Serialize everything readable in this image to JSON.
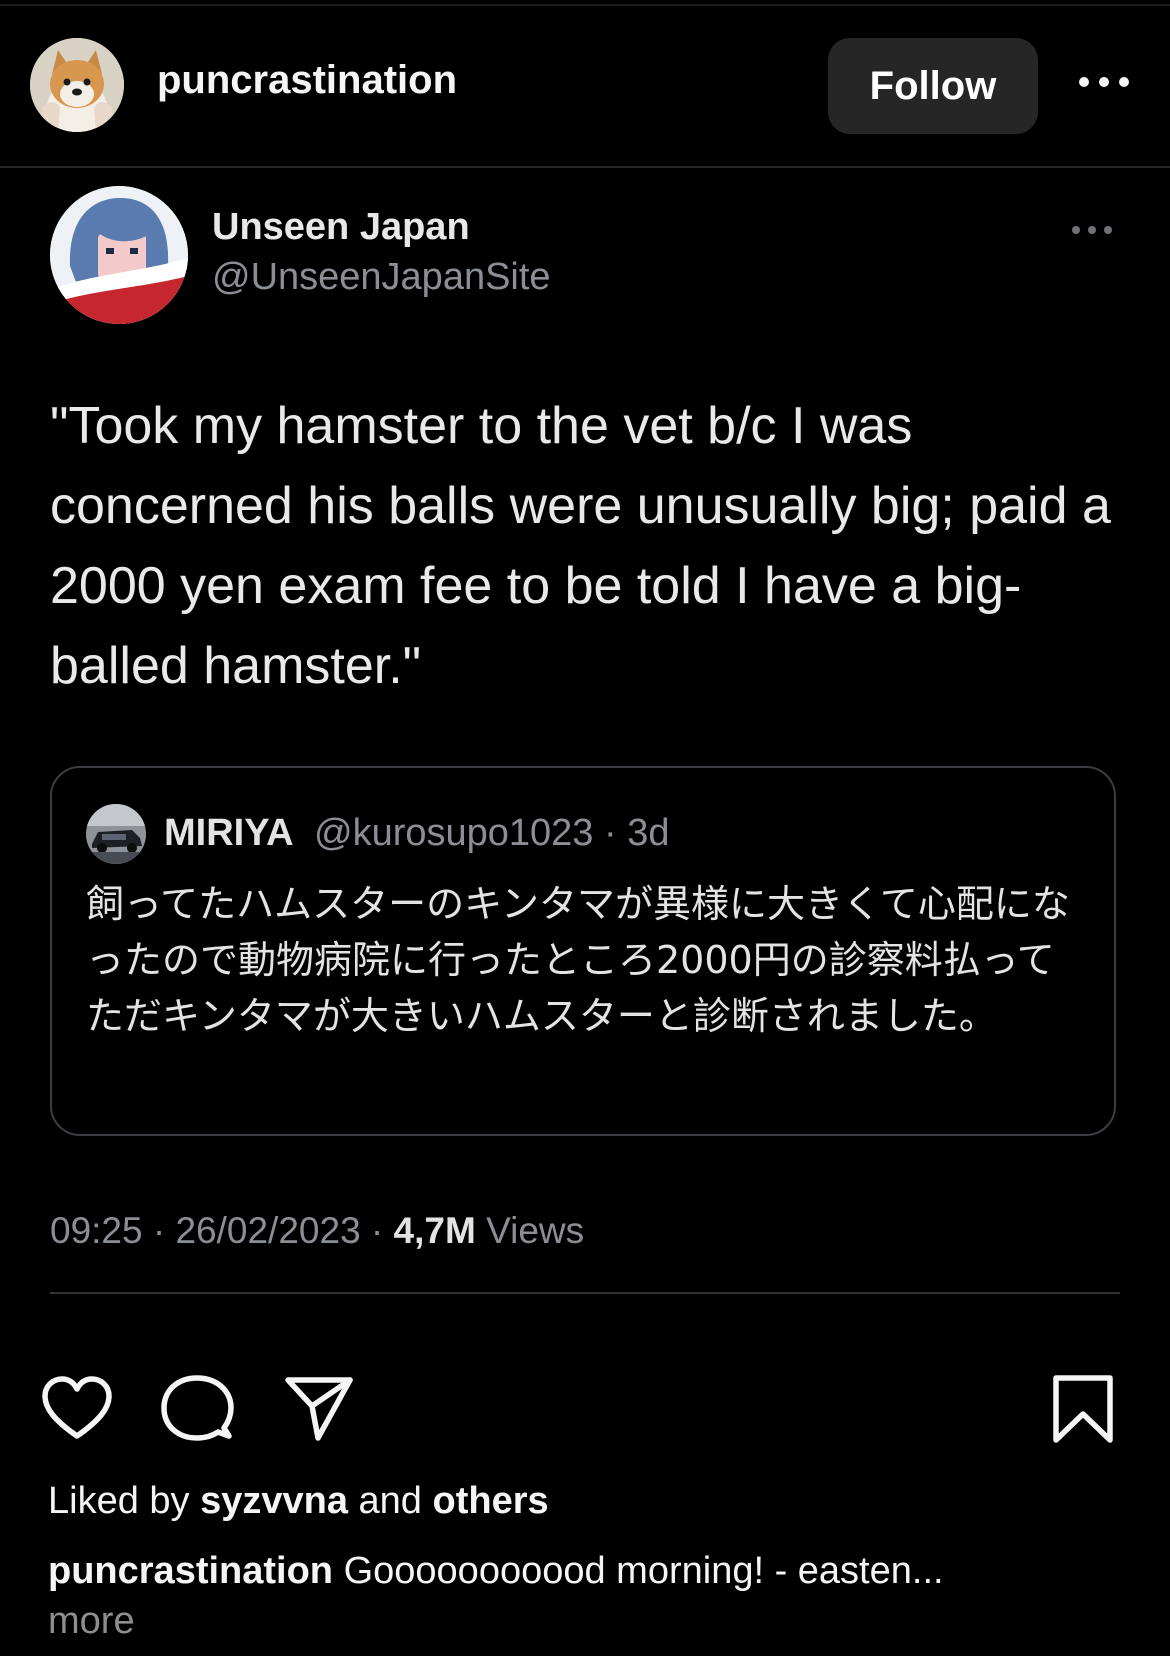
{
  "post": {
    "username": "puncrastination",
    "follow_label": "Follow",
    "more_icon": "more-horizontal-icon"
  },
  "tweet": {
    "name": "Unseen Japan",
    "handle": "@UnseenJapanSite",
    "text": "\"Took my hamster to the vet b/c I was concerned his balls were unusually big; paid a 2000 yen exam fee to be told I have a big-balled hamster.\"",
    "quote": {
      "name": "MIRIYA",
      "meta": "@kurosupo1023 · 3d",
      "text": "飼ってたハムスターのキンタマが異様に大きくて心配になったので動物病院に行ったところ2000円の診察料払ってただキンタマが大きいハムスターと診断されました。"
    },
    "time": "09:25 · 26/02/2023 · ",
    "views_count": "4,7M",
    "views_label": " Views"
  },
  "actions": [
    "heart-icon",
    "comment-icon",
    "share-icon",
    "bookmark-icon"
  ],
  "likes": {
    "prefix": "Liked by ",
    "user": "syzvvna",
    "middle": " and ",
    "others": "others"
  },
  "caption": {
    "user": "puncrastination",
    "text": " Gooooooooood morning! - easten...",
    "more": "more"
  }
}
